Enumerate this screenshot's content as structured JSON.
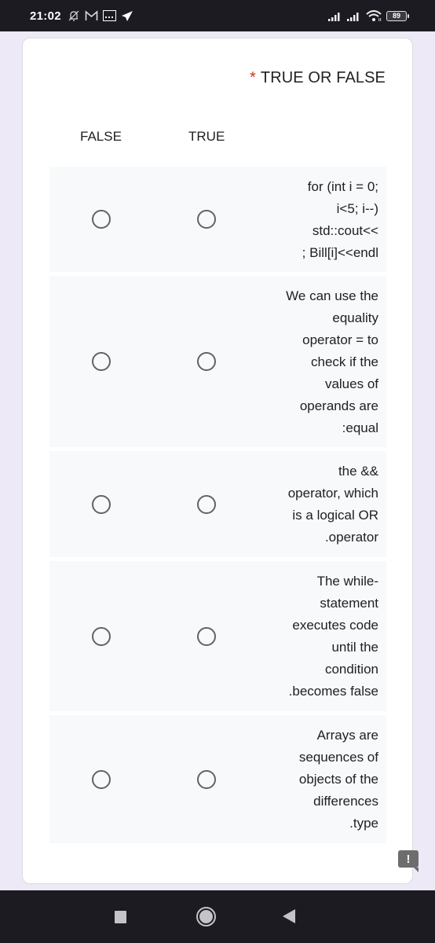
{
  "status_bar": {
    "time": "21:02",
    "left_icons": [
      "muted-bell-icon",
      "gmail-icon",
      "gallery-icon",
      "telegram-icon"
    ],
    "right_icons": [
      "signal-1-icon",
      "signal-2-icon",
      "wifi-icon",
      "battery-icon"
    ],
    "battery_level": "89"
  },
  "question": {
    "required_marker": "*",
    "title": "TRUE OR FALSE",
    "columns": [
      "FALSE",
      "TRUE"
    ],
    "rows": [
      {
        "lines": [
          "for (int i = 0;",
          "i<5; i--)",
          "std::cout<<",
          "; Bill[i]<<endl"
        ],
        "false_selected": false,
        "true_selected": false
      },
      {
        "lines": [
          "We can use the",
          "equality",
          "operator = to",
          "check if the",
          "values of",
          "operands are",
          ":equal"
        ],
        "false_selected": false,
        "true_selected": false
      },
      {
        "lines": [
          "the &&",
          "operator, which",
          "is a logical OR",
          ".operator"
        ],
        "false_selected": false,
        "true_selected": false
      },
      {
        "lines": [
          "The while-",
          "statement",
          "executes code",
          "until the",
          "condition",
          ".becomes false"
        ],
        "false_selected": false,
        "true_selected": false
      },
      {
        "lines": [
          "Arrays are",
          "sequences of",
          "objects of the",
          "differences",
          ".type"
        ],
        "false_selected": false,
        "true_selected": false
      }
    ]
  },
  "feedback": {
    "icon": "feedback-icon",
    "label": "!"
  },
  "nav_bar": {
    "buttons": [
      "recents",
      "home",
      "back"
    ]
  },
  "colors": {
    "required": "#d93025",
    "row_bg": "#f8f9fa",
    "radio_border": "#5f6368",
    "page_bg": "#ede9f6"
  }
}
